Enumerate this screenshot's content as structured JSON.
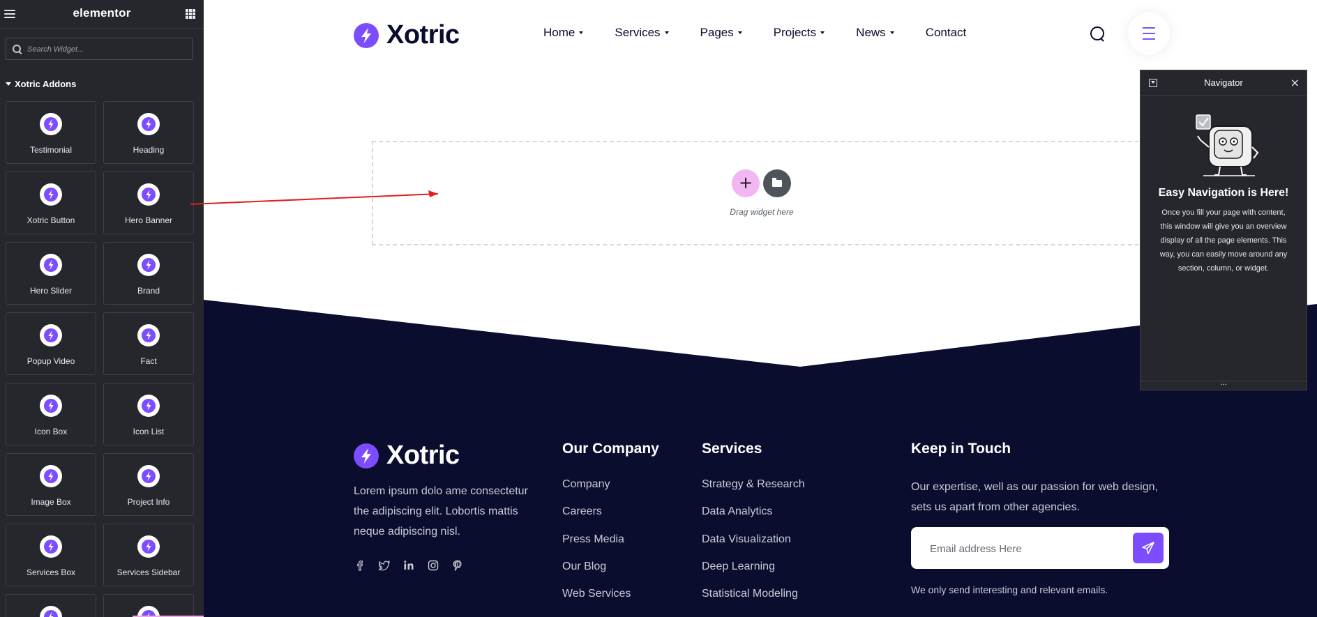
{
  "editor": {
    "logo": "elementor",
    "search_placeholder": "Search Widget...",
    "category": "Xotric Addons",
    "widgets": [
      "Testimonial",
      "Heading",
      "Xotric Button",
      "Hero Banner",
      "Hero Slider",
      "Brand",
      "Popup Video",
      "Fact",
      "Icon Box",
      "Icon List",
      "Image Box",
      "Project Info",
      "Services Box",
      "Services Sidebar"
    ],
    "widget_icon": "bolt-icon"
  },
  "header": {
    "brand": "Xotric",
    "nav": [
      "Home",
      "Services",
      "Pages",
      "Projects",
      "News",
      "Contact"
    ]
  },
  "canvas": {
    "drag_text": "Drag widget here"
  },
  "footer": {
    "brand": "Xotric",
    "about": "Lorem ipsum dolo ame consectetur the adipiscing elit. Lobortis mattis neque adipiscing nisl.",
    "socials": [
      "facebook-icon",
      "twitter-icon",
      "linkedin-icon",
      "instagram-icon",
      "pinterest-icon"
    ],
    "company_title": "Our Company",
    "company_links": [
      "Company",
      "Careers",
      "Press Media",
      "Our Blog",
      "Web Services"
    ],
    "services_title": "Services",
    "services_links": [
      "Strategy & Research",
      "Data Analytics",
      "Data Visualization",
      "Deep Learning",
      "Statistical Modeling"
    ],
    "keep_title": "Keep in Touch",
    "keep_text": "Our expertise, well as our passion for web design, sets us apart from other agencies.",
    "email_placeholder": "Email address Here",
    "email_note": "We only send interesting and relevant emails."
  },
  "navigator": {
    "title": "Navigator",
    "empty_title": "Easy Navigation is Here!",
    "empty_text": "Once you fill your page with content, this window will give you an overview display of all the page elements. This way, you can easily move around any section, column, or widget."
  },
  "colors": {
    "accent": "#7c4dff",
    "footer_bg": "#0b0d2e",
    "editor_bg": "#26272c",
    "add_button": "#f2b6f3"
  }
}
